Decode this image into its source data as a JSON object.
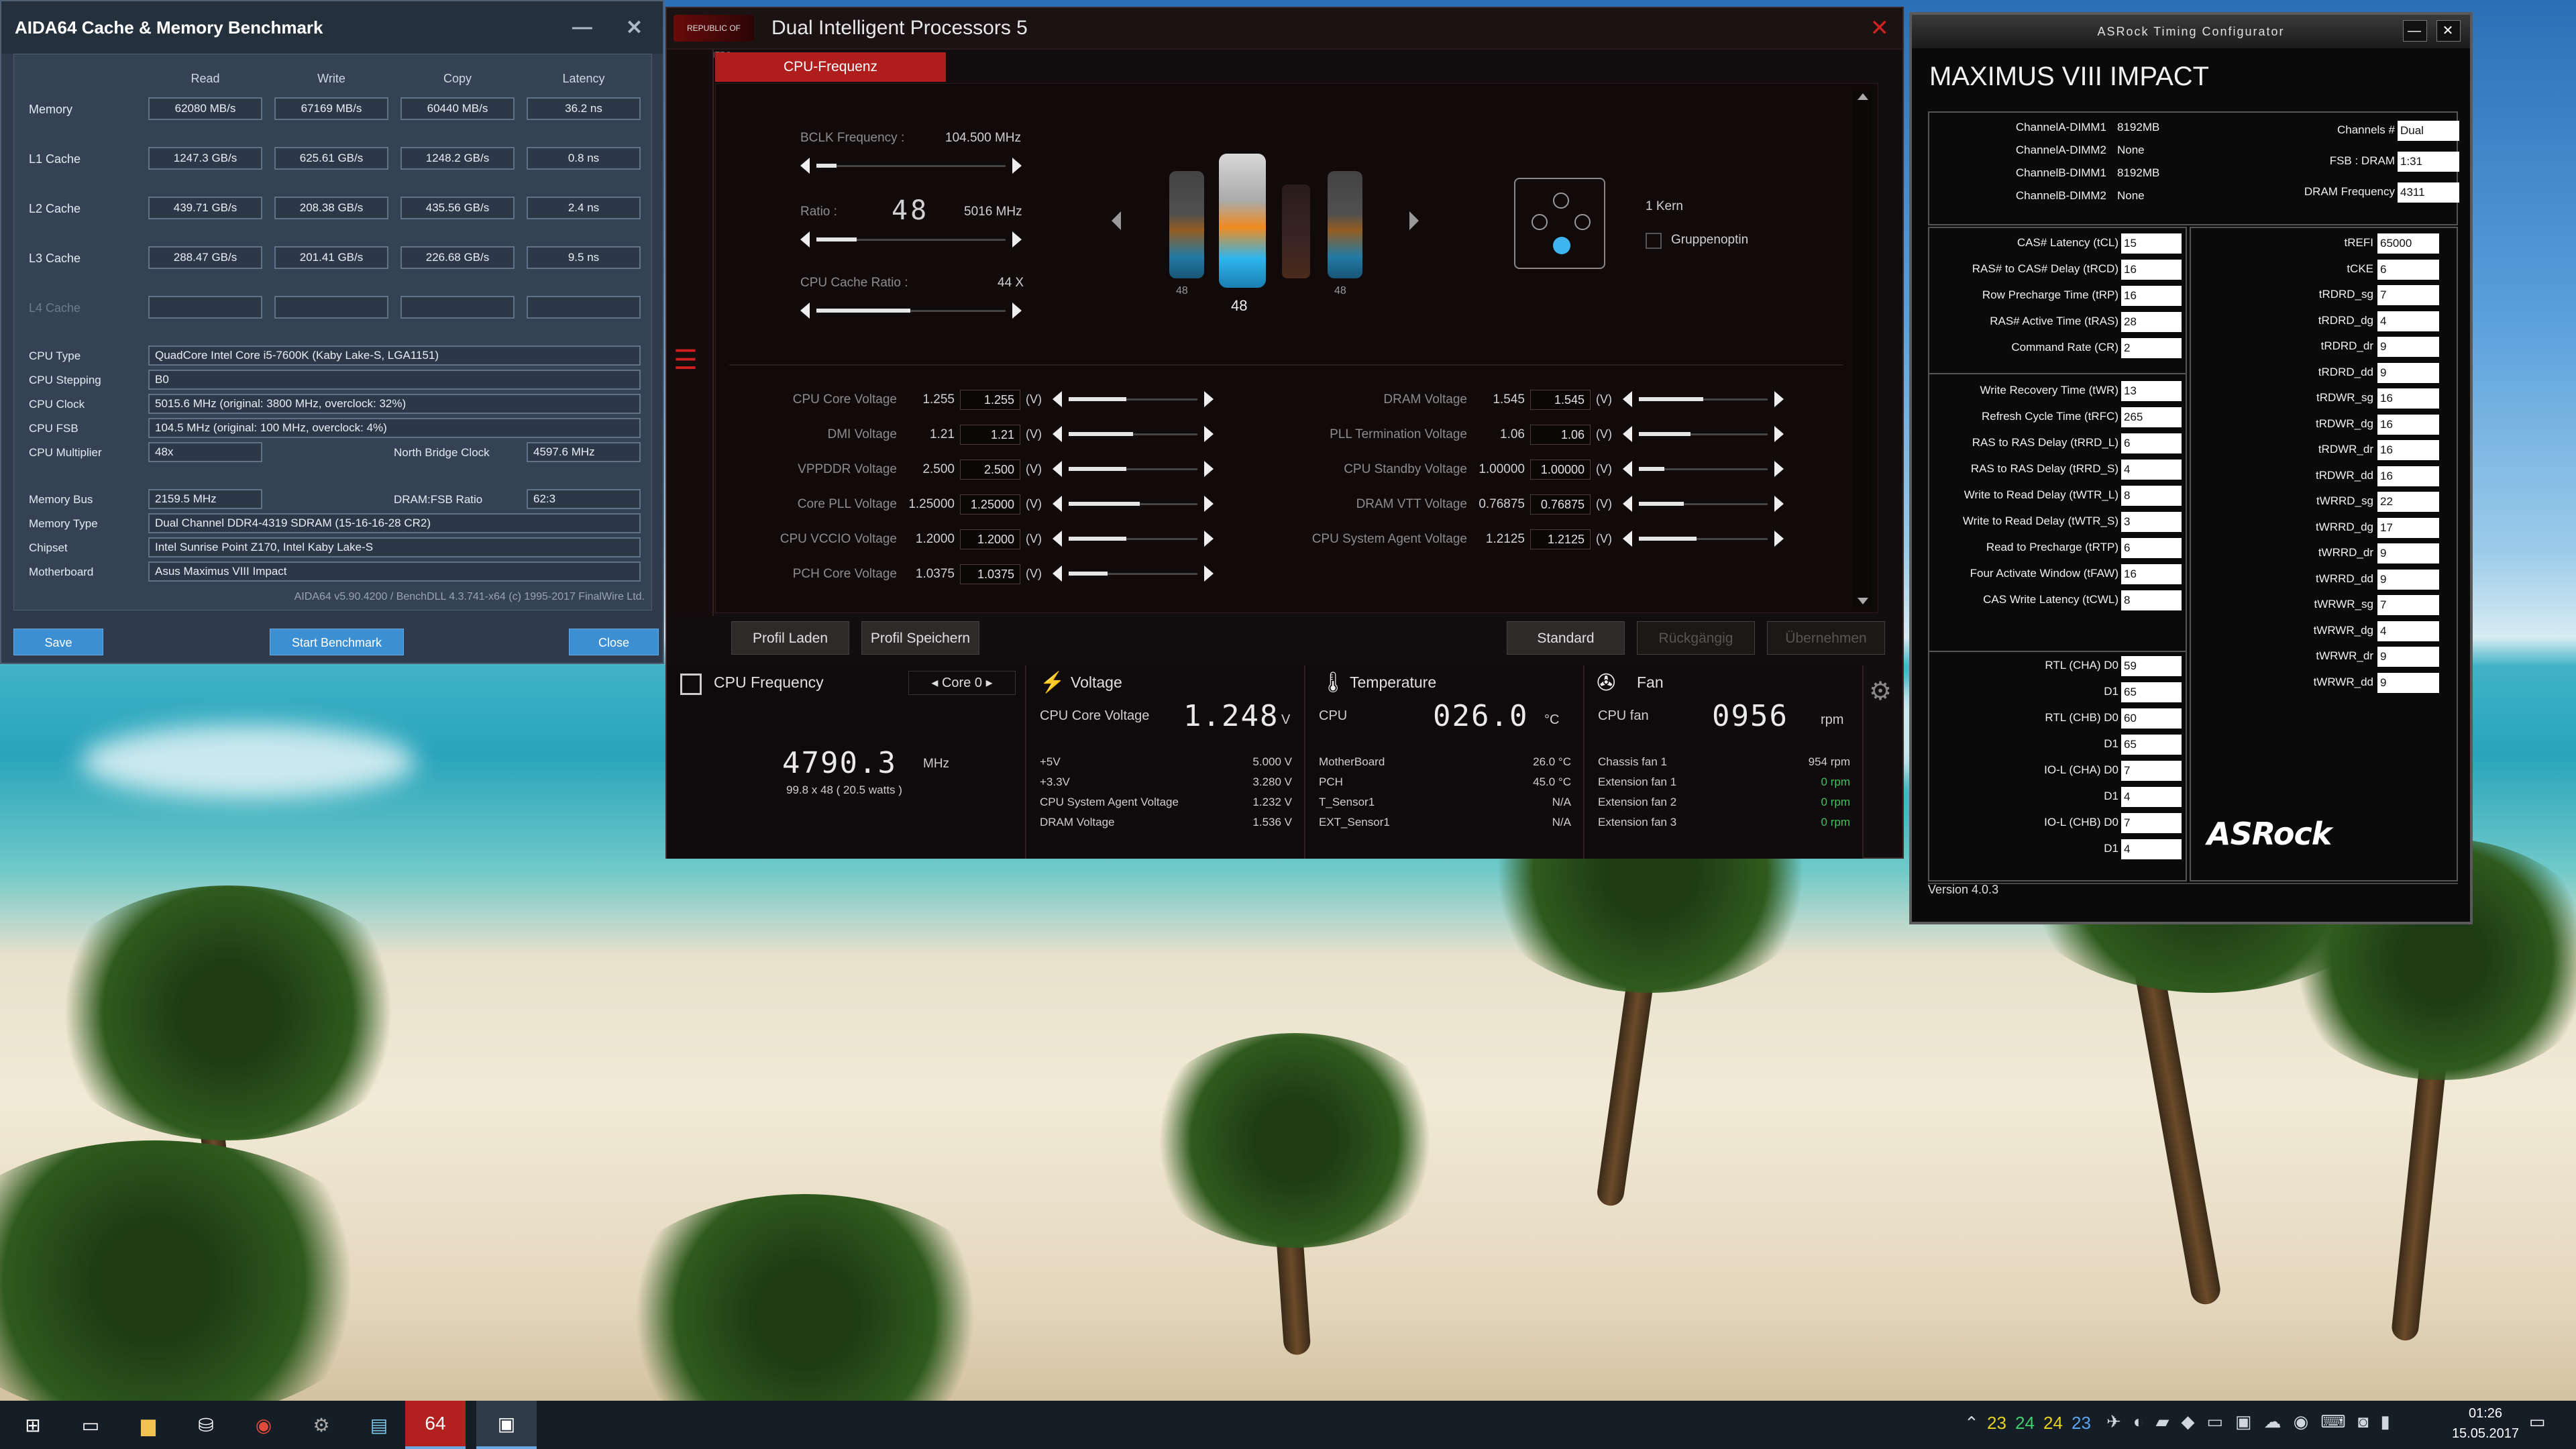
{
  "aida": {
    "title": "AIDA64 Cache & Memory Benchmark",
    "col_headers": [
      "Read",
      "Write",
      "Copy",
      "Latency"
    ],
    "rows": [
      {
        "label": "Memory",
        "values": [
          "62080 MB/s",
          "67169 MB/s",
          "60440 MB/s",
          "36.2 ns"
        ]
      },
      {
        "label": "L1 Cache",
        "values": [
          "1247.3 GB/s",
          "625.61 GB/s",
          "1248.2 GB/s",
          "0.8 ns"
        ]
      },
      {
        "label": "L2 Cache",
        "values": [
          "439.71 GB/s",
          "208.38 GB/s",
          "435.56 GB/s",
          "2.4 ns"
        ]
      },
      {
        "label": "L3 Cache",
        "values": [
          "288.47 GB/s",
          "201.41 GB/s",
          "226.68 GB/s",
          "9.5 ns"
        ]
      },
      {
        "label": "L4 Cache",
        "values": [
          "",
          "",
          "",
          ""
        ]
      }
    ],
    "cpu_type_label": "CPU Type",
    "cpu_type": "QuadCore Intel Core i5-7600K  (Kaby Lake-S, LGA1151)",
    "cpu_stepping_label": "CPU Stepping",
    "cpu_stepping": "B0",
    "cpu_clock_label": "CPU Clock",
    "cpu_clock": "5015.6 MHz  (original: 3800 MHz, overclock: 32%)",
    "cpu_fsb_label": "CPU FSB",
    "cpu_fsb": "104.5 MHz  (original: 100 MHz, overclock: 4%)",
    "cpu_multiplier_label": "CPU Multiplier",
    "cpu_multiplier": "48x",
    "nb_clock_label": "North Bridge Clock",
    "nb_clock": "4597.6 MHz",
    "memory_bus_label": "Memory Bus",
    "memory_bus": "2159.5 MHz",
    "dram_fsb_label": "DRAM:FSB Ratio",
    "dram_fsb": "62:3",
    "memory_type_label": "Memory Type",
    "memory_type": "Dual Channel DDR4-4319 SDRAM  (15-16-16-28 CR2)",
    "chipset_label": "Chipset",
    "chipset": "Intel Sunrise Point Z170, Intel Kaby Lake-S",
    "motherboard_label": "Motherboard",
    "motherboard": "Asus Maximus VIII Impact",
    "footer": "AIDA64 v5.90.4200 / BenchDLL 4.3.741-x64  (c) 1995-2017 FinalWire Ltd.",
    "save": "Save",
    "start": "Start Benchmark",
    "close": "Close"
  },
  "dip": {
    "rog_logo": "REPUBLIC OF GAMERS",
    "title": "Dual Intelligent Processors 5",
    "tab": "CPU-Frequenz",
    "bclk_label": "BCLK Frequency :",
    "bclk_value": "104.500 MHz",
    "ratio_label": "Ratio :",
    "ratio_value": "48",
    "ratio_freq": "5016 MHz",
    "cache_label": "CPU Cache Ratio :",
    "cache_value": "44 X",
    "core_ratios": [
      "48",
      "48",
      "",
      "48"
    ],
    "kern_label": "1 Kern",
    "gruppen_label": "Gruppenoptin",
    "voltages_left": [
      {
        "label": "CPU Core Voltage",
        "v1": "1.255",
        "v2": "1.255",
        "unit": "(V)",
        "level": 0.45
      },
      {
        "label": "DMI Voltage",
        "v1": "1.21",
        "v2": "1.21",
        "unit": "(V)",
        "level": 0.5
      },
      {
        "label": "VPPDDR Voltage",
        "v1": "2.500",
        "v2": "2.500",
        "unit": "(V)",
        "level": 0.45
      },
      {
        "label": "Core PLL Voltage",
        "v1": "1.25000",
        "v2": "1.25000",
        "unit": "(V)",
        "level": 0.55
      },
      {
        "label": "CPU VCCIO Voltage",
        "v1": "1.2000",
        "v2": "1.2000",
        "unit": "(V)",
        "level": 0.45
      },
      {
        "label": "PCH Core Voltage",
        "v1": "1.0375",
        "v2": "1.0375",
        "unit": "(V)",
        "level": 0.3
      }
    ],
    "voltages_right": [
      {
        "label": "DRAM Voltage",
        "v1": "1.545",
        "v2": "1.545",
        "unit": "(V)",
        "level": 0.5
      },
      {
        "label": "PLL Termination Voltage",
        "v1": "1.06",
        "v2": "1.06",
        "unit": "(V)",
        "level": 0.4
      },
      {
        "label": "CPU Standby Voltage",
        "v1": "1.00000",
        "v2": "1.00000",
        "unit": "(V)",
        "level": 0.2
      },
      {
        "label": "DRAM VTT Voltage",
        "v1": "0.76875",
        "v2": "0.76875",
        "unit": "(V)",
        "level": 0.35
      },
      {
        "label": "CPU System Agent Voltage",
        "v1": "1.2125",
        "v2": "1.2125",
        "unit": "(V)",
        "level": 0.45
      }
    ],
    "btn_load": "Profil Laden",
    "btn_save": "Profil Speichern",
    "btn_standard": "Standard",
    "btn_undo": "Rückgängig",
    "btn_apply": "Übernehmen",
    "panel_cpu": {
      "title": "CPU Frequency",
      "core": "Core 0",
      "freq": "4790.3",
      "unit": "MHz",
      "detail": "99.8  x 48  ( 20.5    watts )"
    },
    "panel_volt": {
      "title": "Voltage",
      "main_label": "CPU Core Voltage",
      "main_value": "1.248",
      "main_unit": "V",
      "rows": [
        [
          "+5V",
          "5.000  V"
        ],
        [
          "+3.3V",
          "3.280  V"
        ],
        [
          "CPU System Agent Voltage",
          "1.232  V"
        ],
        [
          "DRAM Voltage",
          "1.536  V"
        ]
      ]
    },
    "panel_temp": {
      "title": "Temperature",
      "main_label": "CPU",
      "main_value": "026.0",
      "main_unit": "°C",
      "rows": [
        [
          "MotherBoard",
          "26.0 °C"
        ],
        [
          "PCH",
          "45.0 °C"
        ],
        [
          "T_Sensor1",
          "N/A"
        ],
        [
          "EXT_Sensor1",
          "N/A"
        ]
      ]
    },
    "panel_fan": {
      "title": "Fan",
      "main_label": "CPU fan",
      "main_value": "0956",
      "main_unit": "rpm",
      "rows": [
        [
          "Chassis fan 1",
          "954  rpm"
        ],
        [
          "Extension fan 1",
          "0  rpm"
        ],
        [
          "Extension fan 2",
          "0  rpm"
        ],
        [
          "Extension fan 3",
          "0  rpm"
        ]
      ]
    }
  },
  "asrock": {
    "title": "ASRock Timing Configurator",
    "board": "MAXIMUS VIII IMPACT",
    "dimms": [
      [
        "ChannelA-DIMM1",
        "8192MB"
      ],
      [
        "ChannelA-DIMM2",
        "None"
      ],
      [
        "ChannelB-DIMM1",
        "8192MB"
      ],
      [
        "ChannelB-DIMM2",
        "None"
      ]
    ],
    "top_right": [
      [
        "Channels #",
        "Dual"
      ],
      [
        "FSB : DRAM",
        "1:31"
      ],
      [
        "DRAM Frequency",
        "4311"
      ]
    ],
    "primary": [
      [
        "CAS# Latency (tCL)",
        "15"
      ],
      [
        "RAS# to CAS# Delay (tRCD)",
        "16"
      ],
      [
        "Row Precharge Time (tRP)",
        "16"
      ],
      [
        "RAS# Active Time (tRAS)",
        "28"
      ],
      [
        "Command Rate (CR)",
        "2"
      ]
    ],
    "secondary": [
      [
        "Write Recovery Time (tWR)",
        "13"
      ],
      [
        "Refresh Cycle Time (tRFC)",
        "265"
      ],
      [
        "RAS to RAS Delay (tRRD_L)",
        "6"
      ],
      [
        "RAS to RAS Delay (tRRD_S)",
        "4"
      ],
      [
        "Write to Read Delay (tWTR_L)",
        "8"
      ],
      [
        "Write to Read Delay (tWTR_S)",
        "3"
      ],
      [
        "Read to Precharge (tRTP)",
        "6"
      ],
      [
        "Four Activate Window (tFAW)",
        "16"
      ],
      [
        "CAS Write Latency (tCWL)",
        "8"
      ]
    ],
    "rtl": [
      [
        "RTL (CHA) D0",
        "59"
      ],
      [
        "D1",
        "65"
      ],
      [
        "RTL (CHB) D0",
        "60"
      ],
      [
        "D1",
        "65"
      ],
      [
        "IO-L (CHA) D0",
        "7"
      ],
      [
        "D1",
        "4"
      ],
      [
        "IO-L (CHB) D0",
        "7"
      ],
      [
        "D1",
        "4"
      ]
    ],
    "right": [
      [
        "tREFI",
        "65000"
      ],
      [
        "tCKE",
        "6"
      ],
      [
        "tRDRD_sg",
        "7"
      ],
      [
        "tRDRD_dg",
        "4"
      ],
      [
        "tRDRD_dr",
        "9"
      ],
      [
        "tRDRD_dd",
        "9"
      ],
      [
        "tRDWR_sg",
        "16"
      ],
      [
        "tRDWR_dg",
        "16"
      ],
      [
        "tRDWR_dr",
        "16"
      ],
      [
        "tRDWR_dd",
        "16"
      ],
      [
        "tWRRD_sg",
        "22"
      ],
      [
        "tWRRD_dg",
        "17"
      ],
      [
        "tWRRD_dr",
        "9"
      ],
      [
        "tWRRD_dd",
        "9"
      ],
      [
        "tWRWR_sg",
        "7"
      ],
      [
        "tWRWR_dg",
        "4"
      ],
      [
        "tWRWR_dr",
        "9"
      ],
      [
        "tWRWR_dd",
        "9"
      ]
    ],
    "logo": "ASRock",
    "version": "Version 4.0.3"
  },
  "taskbar": {
    "temps": [
      "23",
      "24",
      "24",
      "23"
    ],
    "time": "01:26",
    "date": "15.05.2017",
    "icons": [
      "windows-start-icon",
      "task-view-icon",
      "file-explorer-icon",
      "store-icon",
      "chrome-icon",
      "cpu-z-icon",
      "hwinfo-icon",
      "aida64-icon",
      "dip5-icon"
    ]
  }
}
